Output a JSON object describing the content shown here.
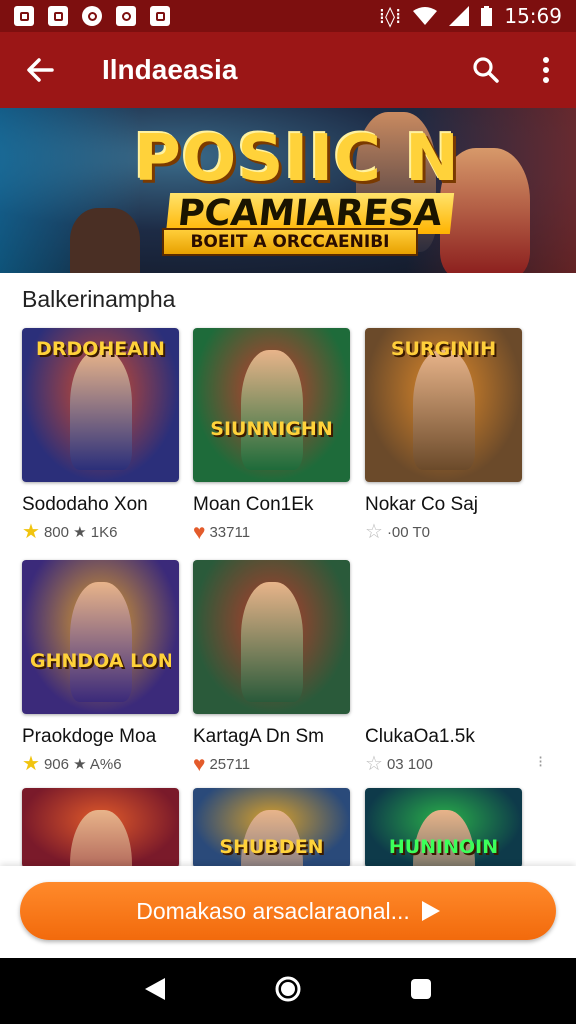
{
  "status_bar": {
    "time": "15:69",
    "notification_icons": [
      "image-icon",
      "chart-icon",
      "messenger-icon",
      "instagram-icon",
      "chat-icon"
    ]
  },
  "app_bar": {
    "title": "Ilndaeasia",
    "back_icon": "arrow-left-icon",
    "search_icon": "search-icon",
    "menu_icon": "more-vert-icon"
  },
  "banner": {
    "title": "POSIIC N",
    "subtitle": "PCAMIARESA",
    "ribbon": "BOEIT A ORCCAENIBI"
  },
  "section": {
    "title": "Balkerinampha"
  },
  "games": [
    {
      "thumb_text": "DRDOHEAIN",
      "name": "Sododaho Xon",
      "meta_icon": "star",
      "meta": "800 ★ 1K6",
      "colors": [
        "#2b2f7a",
        "#d24b2a"
      ]
    },
    {
      "thumb_text": "SIUNNIGHN",
      "name": "Moan Con1Ek",
      "meta_icon": "heart",
      "meta": "33711",
      "colors": [
        "#1e6b3a",
        "#c83a2c"
      ]
    },
    {
      "thumb_text": "SURGINIH",
      "name": "Nokar Co Saj",
      "meta_icon": "star-outline",
      "meta": "·00 T0",
      "colors": [
        "#6b4a2a",
        "#e08a2a"
      ]
    },
    {
      "thumb_text": "GHNDOA LONDSSS",
      "name": "Praokdoge Moa",
      "meta_icon": "star",
      "meta": "906 ★ A%6",
      "colors": [
        "#3b2a7a",
        "#e0a02a"
      ]
    },
    {
      "thumb_text": "",
      "name": "KartagA Dn Sm",
      "meta_icon": "heart",
      "meta": "25711",
      "colors": [
        "#2a5a3a",
        "#b83a2a"
      ]
    },
    {
      "thumb_text": "",
      "name": "ClukaOa1.5k",
      "meta_icon": "star-outline",
      "meta": "03 100",
      "colors": [],
      "empty": true
    },
    {
      "thumb_text": "",
      "name": "",
      "meta": "",
      "colors": [
        "#7a1a2a",
        "#e05a2a"
      ]
    },
    {
      "thumb_text": "SHUBDEN",
      "name": "",
      "meta": "",
      "colors": [
        "#2a4a7a",
        "#d8a02a"
      ]
    },
    {
      "thumb_text": "HUNINOIN",
      "name": "",
      "meta": "",
      "colors": [
        "#0e3a4a",
        "#2ab04a"
      ]
    }
  ],
  "cta": {
    "label": "Domakaso arsaclaraonal...",
    "icon": "play-icon"
  },
  "nav": {
    "back": "nav-back-icon",
    "home": "nav-home-icon",
    "recents": "nav-recents-icon"
  }
}
